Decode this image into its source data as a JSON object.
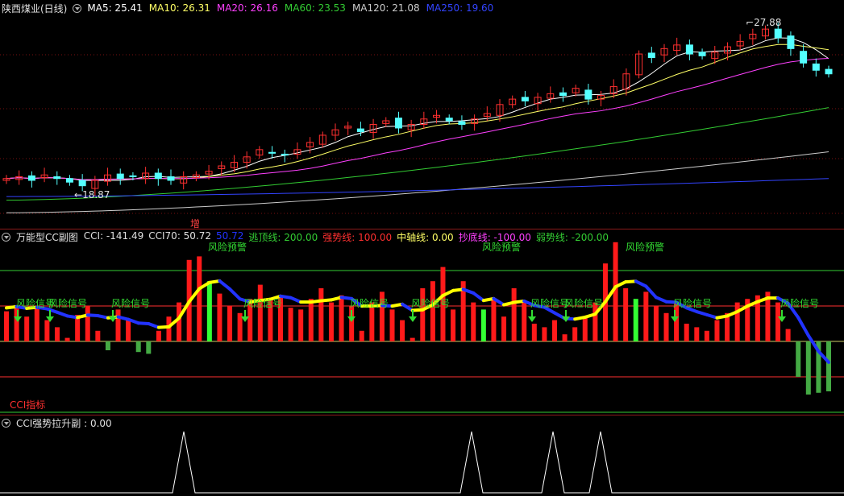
{
  "colors": {
    "up": "#ff3030",
    "down": "#54ffff",
    "ma5": "#ffffff",
    "ma10": "#ffff66",
    "ma20": "#ff40ff",
    "ma60": "#33cc33",
    "ma120": "#cccccc",
    "ma250": "#3344ff",
    "cci_yellow": "#ffff00",
    "cci_blue": "#2233ff",
    "red_bar": "#ff1a1a",
    "green_bar": "#33ff33",
    "signal_green": "#33dd33"
  },
  "main_panel": {
    "title": "陕西煤业(日线)",
    "ma": [
      {
        "label": "MA5: 25.41",
        "color": "#ffffff"
      },
      {
        "label": "MA10: 26.31",
        "color": "#ffff66"
      },
      {
        "label": "MA20: 26.16",
        "color": "#ff40ff"
      },
      {
        "label": "MA60: 23.53",
        "color": "#33cc33"
      },
      {
        "label": "MA120: 21.08",
        "color": "#cccccc"
      },
      {
        "label": "MA250: 19.60",
        "color": "#3344ff"
      }
    ],
    "high_marker": "27.88",
    "low_marker": "18.87",
    "zeng_label": "增"
  },
  "cci_panel": {
    "title": "万能型CC副图",
    "values": [
      {
        "label": "CCI: -141.49",
        "color": "#e0e0e0"
      },
      {
        "label": "CCI70: 50.72",
        "color": "#e0e0e0"
      },
      {
        "label": "50.72",
        "color": "#2233ff"
      },
      {
        "label": "逃顶线: 200.00",
        "color": "#33cc33"
      },
      {
        "label": "强势线: 100.00",
        "color": "#ff3030"
      },
      {
        "label": "中轴线: 0.00",
        "color": "#ffff66"
      },
      {
        "label": "抄底线: -100.00",
        "color": "#ff40ff"
      },
      {
        "label": "弱势线: -200.00",
        "color": "#33cc33"
      }
    ],
    "risk_warning": "风险预警",
    "risk_signal": "风险信号",
    "indicator_label": "CCI指标"
  },
  "bottom_panel": {
    "title": "CCI强势拉升副 : 0.00"
  },
  "chart_data": [
    {
      "type": "candlestick",
      "title": "陕西煤业(日线)",
      "ohlc_approx_close": [
        19.6,
        19.7,
        19.5,
        19.8,
        19.6,
        19.4,
        19.2,
        19.5,
        19.8,
        19.6,
        19.7,
        19.9,
        19.6,
        19.5,
        19.7,
        19.8,
        20.0,
        20.3,
        20.5,
        20.8,
        21.2,
        21.0,
        20.9,
        21.2,
        21.6,
        22.0,
        22.3,
        22.5,
        22.2,
        22.6,
        22.8,
        22.4,
        22.6,
        22.9,
        23.1,
        22.8,
        22.6,
        22.9,
        23.2,
        23.7,
        24.0,
        23.9,
        24.1,
        24.3,
        24.2,
        24.6,
        24.0,
        24.2,
        24.7,
        25.4,
        26.5,
        26.3,
        26.8,
        27.0,
        26.5,
        26.4,
        26.6,
        26.9,
        27.2,
        27.6,
        27.88,
        27.4,
        26.8,
        26.0,
        25.6,
        25.4
      ],
      "high": 27.88,
      "low": 18.87
    },
    {
      "type": "bar",
      "title": "万能型CC副图",
      "reference_lines": {
        "逃顶线": 200,
        "强势线": 100,
        "中轴线": 0,
        "抄底线": -100,
        "弱势线": -200
      },
      "cci": [
        85,
        95,
        70,
        100,
        60,
        40,
        10,
        75,
        100,
        30,
        -25,
        90,
        60,
        -30,
        -35,
        30,
        70,
        110,
        230,
        240,
        170,
        135,
        100,
        80,
        120,
        160,
        120,
        130,
        95,
        90,
        120,
        150,
        110,
        130,
        100,
        30,
        110,
        140,
        90,
        60,
        10,
        150,
        170,
        210,
        90,
        170,
        110,
        90,
        120,
        70,
        150,
        110,
        50,
        40,
        60,
        20,
        40,
        70,
        110,
        220,
        280,
        150,
        120,
        140,
        100,
        80,
        110,
        50,
        40,
        30,
        60,
        80,
        110,
        120,
        130,
        140,
        110,
        35,
        -100,
        -150,
        -145,
        -141
      ],
      "cci70_last": 50.72
    },
    {
      "type": "line",
      "title": "CCI强势拉升副",
      "value": 0.0
    }
  ]
}
